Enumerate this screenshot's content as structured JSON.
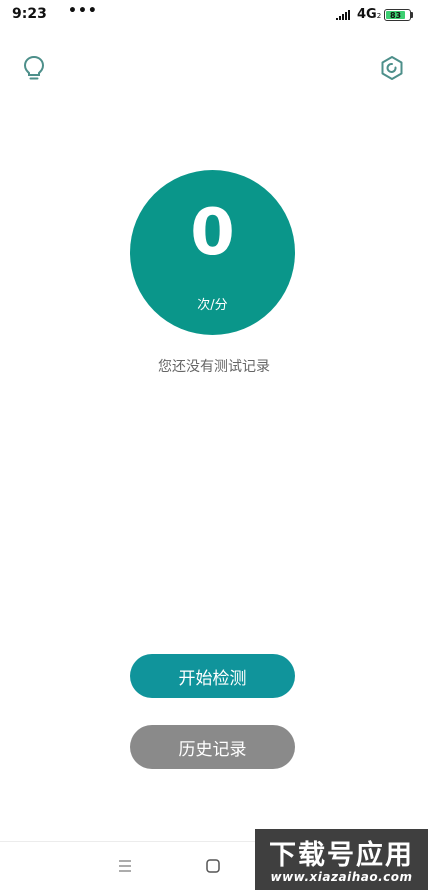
{
  "status_bar": {
    "time": "9:23",
    "dots": "•••",
    "network": "4G",
    "network_suffix": "2",
    "battery": "83"
  },
  "header": {
    "left_icon": "bulb-icon",
    "right_icon": "settings-hex-icon"
  },
  "rate": {
    "value": "0",
    "unit": "次/分",
    "color": "#0a968a"
  },
  "empty_message": "您还没有测试记录",
  "buttons": {
    "start": "开始检测",
    "history": "历史记录",
    "start_color": "#10949b",
    "history_color": "#8a8a8a"
  },
  "nav_bar": {
    "menu_icon": "menu-icon",
    "home_icon": "home-square-icon"
  },
  "watermark": {
    "title": "下载号应用",
    "url": "www.xiazaihao.com"
  }
}
